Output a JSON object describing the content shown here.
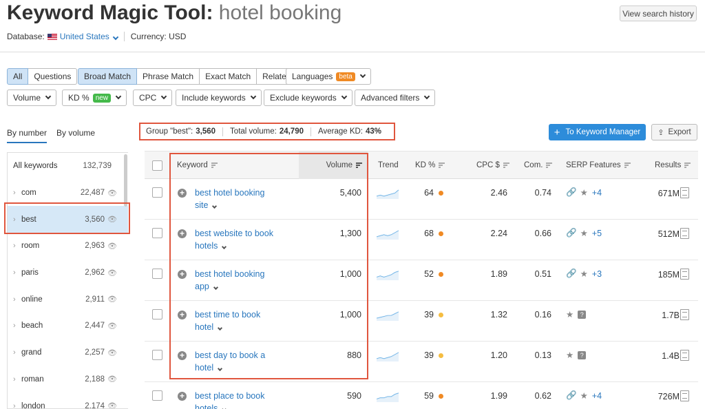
{
  "header": {
    "title_main": "Keyword Magic Tool: ",
    "title_query": "hotel booking",
    "history_button": "View search history",
    "database_label": "Database:",
    "database_value": "United States",
    "currency_label": "Currency: USD"
  },
  "filters": {
    "type_tabs": [
      "All",
      "Questions"
    ],
    "match_tabs": [
      "Broad Match",
      "Phrase Match",
      "Exact Match",
      "Related"
    ],
    "languages": "Languages",
    "beta": "beta",
    "volume": "Volume",
    "kd": "KD %",
    "new": "new",
    "cpc": "CPC",
    "include": "Include keywords",
    "exclude": "Exclude keywords",
    "advanced": "Advanced filters"
  },
  "sidebar": {
    "tab_by_number": "By number",
    "tab_by_volume": "By volume",
    "all_label": "All keywords",
    "all_count": "132,739",
    "items": [
      {
        "name": "com",
        "count": "22,487"
      },
      {
        "name": "best",
        "count": "3,560"
      },
      {
        "name": "room",
        "count": "2,963"
      },
      {
        "name": "paris",
        "count": "2,962"
      },
      {
        "name": "online",
        "count": "2,911"
      },
      {
        "name": "beach",
        "count": "2,447"
      },
      {
        "name": "grand",
        "count": "2,257"
      },
      {
        "name": "roman",
        "count": "2,188"
      },
      {
        "name": "london",
        "count": "2,174"
      }
    ]
  },
  "stats": {
    "group_label": "Group \"best\":",
    "group_value": "3,560",
    "volume_label": "Total volume:",
    "volume_value": "24,790",
    "kd_label": "Average KD:",
    "kd_value": "43%"
  },
  "actions": {
    "manager": "To Keyword Manager",
    "export": "Export"
  },
  "table": {
    "headers": {
      "keyword": "Keyword",
      "volume": "Volume",
      "trend": "Trend",
      "kd": "KD %",
      "cpc": "CPC $",
      "com": "Com.",
      "serp": "SERP Features",
      "results": "Results"
    },
    "rows": [
      {
        "line1": "best hotel booking",
        "line2": "site",
        "volume": "5,400",
        "kd": "64",
        "kd_color": "#f08a24",
        "cpc": "2.46",
        "com": "0.74",
        "serp": "link",
        "more": "+4",
        "results": "671M",
        "trend": [
          5,
          6,
          5,
          6,
          7,
          8,
          11
        ]
      },
      {
        "line1": "best website to book",
        "line2": "hotels",
        "volume": "1,300",
        "kd": "68",
        "kd_color": "#f08a24",
        "cpc": "2.24",
        "com": "0.66",
        "serp": "link",
        "more": "+5",
        "results": "512M",
        "trend": [
          5,
          6,
          7,
          6,
          7,
          9,
          11
        ]
      },
      {
        "line1": "best hotel booking",
        "line2": "app",
        "volume": "1,000",
        "kd": "52",
        "kd_color": "#f08a24",
        "cpc": "1.89",
        "com": "0.51",
        "serp": "link",
        "more": "+3",
        "results": "185M",
        "trend": [
          6,
          7,
          6,
          7,
          8,
          10,
          11
        ]
      },
      {
        "line1": "best time to book",
        "line2": "hotel",
        "volume": "1,000",
        "kd": "39",
        "kd_color": "#f5bd41",
        "cpc": "1.32",
        "com": "0.16",
        "serp": "star",
        "more": "",
        "results": "1.7B",
        "trend": [
          4,
          5,
          6,
          7,
          7,
          9,
          11
        ]
      },
      {
        "line1": "best day to book a",
        "line2": "hotel",
        "volume": "880",
        "kd": "39",
        "kd_color": "#f5bd41",
        "cpc": "1.20",
        "com": "0.13",
        "serp": "star",
        "more": "",
        "results": "1.4B",
        "trend": [
          5,
          6,
          5,
          6,
          7,
          9,
          11
        ]
      },
      {
        "line1": "best place to book",
        "line2": "hotels",
        "volume": "590",
        "kd": "59",
        "kd_color": "#f08a24",
        "cpc": "1.99",
        "com": "0.62",
        "serp": "link",
        "more": "+4",
        "results": "726M",
        "trend": [
          5,
          6,
          6,
          7,
          7,
          9,
          10
        ]
      }
    ]
  }
}
